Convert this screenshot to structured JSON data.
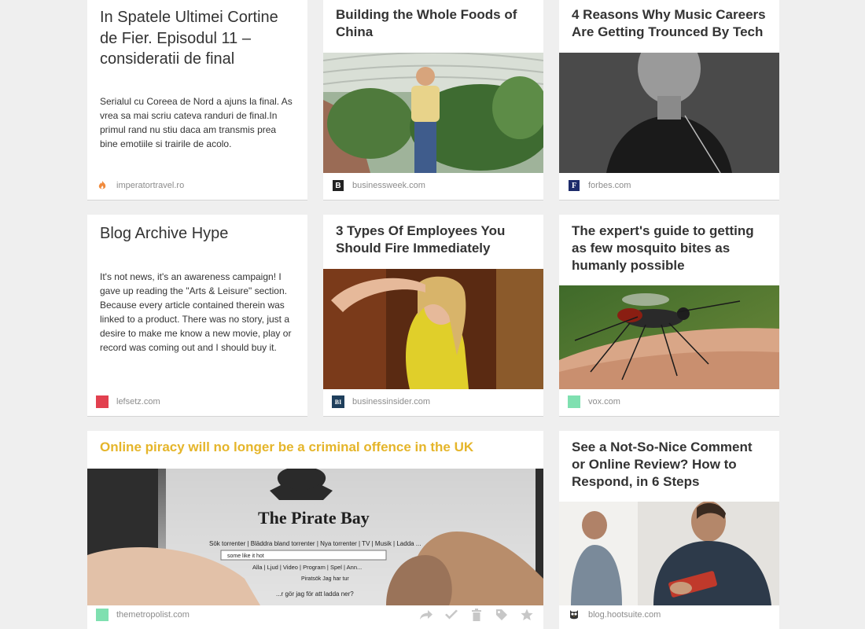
{
  "cards": [
    {
      "title": "In Spatele Ultimei Cortine de Fier. Episodul 11 – consideratii de final",
      "excerpt": "Serialul cu Coreea de Nord a ajuns la final. As vrea sa mai scriu cateva randuri de final.In primul rand nu stiu daca am transmis prea bine emotiile si trairile de acolo.",
      "domain": "imperatortravel.ro",
      "favicon": "flame-icon"
    },
    {
      "title": "Building the Whole Foods of China",
      "domain": "businessweek.com",
      "favicon": "businessweek-b-icon",
      "favicon_text": "B"
    },
    {
      "title": "4 Reasons Why Music Careers Are Getting Trounced By Tech",
      "domain": "forbes.com",
      "favicon": "forbes-f-icon",
      "favicon_text": "F"
    },
    {
      "title": "Blog Archive Hype",
      "excerpt": "It's not news, it's an awareness campaign! I gave up reading the \"Arts & Leisure\" section. Because every article contained therein was linked to a product. There was no story, just a desire to make me know a new movie, play or record was coming out and I should buy it.",
      "domain": "lefsetz.com",
      "favicon": "red-square-icon"
    },
    {
      "title": "3 Types Of Employees You Should Fire Immediately",
      "domain": "businessinsider.com",
      "favicon": "businessinsider-bi-icon",
      "favicon_text": "BI"
    },
    {
      "title": "The expert's guide to getting as few mosquito bites as humanly possible",
      "domain": "vox.com",
      "favicon": "green-square-icon"
    },
    {
      "title": "Online piracy will no longer be a criminal offence in the UK",
      "domain": "themetropolist.com",
      "favicon": "green-square-icon",
      "photo_text": {
        "logo": "The Pirate Bay",
        "nav": "Sök torrenter | Bläddra bland torrenter | Nya torrenter | TV | Musik | Ladda ...",
        "search_value": "some like it hot",
        "options": "Alla | Ljud | Video | Program | Spel | Ann...",
        "buttons": "Piratsök   Jag har tur",
        "footer_line": "...r gör jag för att ladda ner?"
      }
    },
    {
      "title": "See a Not-So-Nice Comment or Online Review? How to Respond, in 6 Steps",
      "domain": "blog.hootsuite.com",
      "favicon": "owl-icon"
    }
  ],
  "actions": [
    "share-icon",
    "check-icon",
    "trash-icon",
    "tag-icon",
    "star-icon"
  ],
  "colors": {
    "background": "#efefef",
    "card": "#ffffff",
    "title": "#333333",
    "highlight_title": "#e5b52a",
    "domain": "#8c8c8c"
  }
}
